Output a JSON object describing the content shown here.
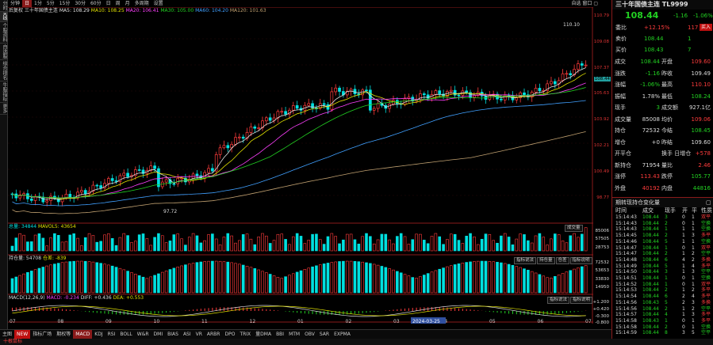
{
  "left_tabs": [
    {
      "label": "分时"
    },
    {
      "label": "K线",
      "active": true
    },
    {
      "label": "个股资料"
    },
    {
      "label": "自选股"
    },
    {
      "label": "综合排名"
    },
    {
      "label": "牛股指标"
    },
    {
      "label": "更多"
    }
  ],
  "toolbar": {
    "items": [
      {
        "label": "分钟"
      },
      {
        "label": "日",
        "active": true
      },
      {
        "label": "1分"
      },
      {
        "label": "5分"
      },
      {
        "label": "15分"
      },
      {
        "label": "30分"
      },
      {
        "label": "60分"
      },
      {
        "label": "日"
      },
      {
        "label": "周"
      },
      {
        "label": "月"
      },
      {
        "label": "多周期"
      },
      {
        "label": "设置"
      }
    ],
    "right": "自选 窗口 ▢"
  },
  "ma_legend": {
    "prefix": "后复权 三十年国债主连",
    "ma5": "MA5: 108.29",
    "ma10": "MA10: 108.25",
    "ma20": "MA20: 106.41",
    "ma30": "MA30: 105.00",
    "ma60": "MA60: 104.20",
    "ma120": "MA120: 101.63"
  },
  "price_axis": [
    "110.79",
    "109.08",
    "107.37",
    "105.63",
    "103.92",
    "102.21",
    "100.49",
    "98.77"
  ],
  "price_tag": "108.44",
  "high_label": "110.10",
  "low_label": "97.72",
  "vol_legend": {
    "title": "总量: 34844",
    "ma": "MAVOL5: 43654"
  },
  "vol_axis": [
    "85006",
    "57505",
    "28753"
  ],
  "vol_btn": "成交量",
  "oi_legend": {
    "title": "持仓量: 54708",
    "sub": "仓差: -839"
  },
  "oi_buttons": [
    "指标说法",
    "持仓量",
    "仓差",
    "指标说明"
  ],
  "oi_axis": [
    "72532",
    "53653",
    "33830",
    "14950"
  ],
  "macd_legend": {
    "title": "MACD(12,26,9)",
    "macd": "MACD: -0.234",
    "dif": "DIFF: +0.436",
    "dea": "DEA: +0.553"
  },
  "macd_buttons": [
    "指标说法",
    "指标说明"
  ],
  "macd_axis": [
    "+1.200",
    "+0.420",
    "-0.300",
    "-0.800"
  ],
  "x_labels": [
    "07",
    "08",
    "09",
    "10",
    "11",
    "12",
    "01",
    "02",
    "03",
    "04",
    "05",
    "06",
    "07"
  ],
  "date_tag": "2024-03-25",
  "bottom_tabs": [
    {
      "label": "主图"
    },
    {
      "label": "NEW"
    },
    {
      "label": "指标广场"
    },
    {
      "label": "期权等"
    },
    {
      "label": "MACD",
      "active": true
    },
    {
      "label": "KDJ"
    },
    {
      "label": "RSI"
    },
    {
      "label": "BOLL"
    },
    {
      "label": "W&R"
    },
    {
      "label": "DMI"
    },
    {
      "label": "BIAS"
    },
    {
      "label": "ASI"
    },
    {
      "label": "VR"
    },
    {
      "label": "ARBR"
    },
    {
      "label": "DPO"
    },
    {
      "label": "TRIX"
    },
    {
      "label": "量DMA"
    },
    {
      "label": "BBI"
    },
    {
      "label": "MTM"
    },
    {
      "label": "OBV"
    },
    {
      "label": "SAR"
    },
    {
      "label": "EXPMA"
    }
  ],
  "status": "十根鼠标",
  "quote": {
    "name": "三十年国债主连 TL9999",
    "price": "108.44",
    "change": "-1.16",
    "pct": "-1.06%"
  },
  "ticket": [
    {
      "l": "委比",
      "v": "+12.15%",
      "v2": "117",
      "v2c": "red",
      "vc": "red",
      "tag": "买入"
    },
    {
      "l": "卖价",
      "v": "108.44",
      "v2": "1",
      "vc": "green",
      "v2c": "green"
    },
    {
      "l": "买价",
      "v": "108.43",
      "v2": "7",
      "vc": "green",
      "v2c": "green"
    }
  ],
  "stats": [
    [
      "成交",
      "108.44",
      "green",
      "开盘",
      "109.60",
      "red"
    ],
    [
      "涨跌",
      "-1.16",
      "green",
      "昨收",
      "109.49",
      "white"
    ],
    [
      "涨幅",
      "-1.06%",
      "green",
      "最高",
      "110.10",
      "red"
    ],
    [
      "振幅",
      "1.78%",
      "white",
      "最低",
      "108.24",
      "green"
    ],
    [
      "现手",
      "3",
      "green",
      "成交额",
      "927.1亿",
      "white"
    ],
    [
      "成交量",
      "85008",
      "white",
      "均价",
      "109.06",
      "red"
    ],
    [
      "持仓",
      "72532",
      "white",
      "今结",
      "108.45",
      "green"
    ],
    [
      "增仓",
      "+0",
      "white",
      "昨结",
      "109.60",
      "white"
    ],
    [
      "开平仓",
      "",
      "white",
      "换手 日增仓",
      "+578",
      "red"
    ],
    [
      "新持仓",
      "71954",
      "white",
      "量比",
      "2.46",
      "red"
    ],
    [
      "涨停",
      "113.43",
      "red",
      "跌停",
      "105.77",
      "green"
    ],
    [
      "外盘",
      "40192",
      "red",
      "内盘",
      "44816",
      "green"
    ]
  ],
  "ticks_title": "期转现持仓变化量",
  "ticks_head": [
    "时间",
    "成交",
    "现手",
    "开",
    "平",
    "性质"
  ],
  "ticks": [
    [
      "15:14:43",
      "108.44",
      "3",
      "0",
      "1",
      "双平"
    ],
    [
      "15:14:43",
      "108.44",
      "2",
      "0",
      "1",
      "空换"
    ],
    [
      "15:14:43",
      "108.44",
      "1",
      "1",
      "1",
      "空换"
    ],
    [
      "15:14:45",
      "108.44",
      "2",
      "1",
      "3",
      "多平"
    ],
    [
      "15:14:46",
      "108.44",
      "5",
      "1",
      "1",
      "空换"
    ],
    [
      "15:14:47",
      "108.44",
      "1",
      "0",
      "1",
      "双平"
    ],
    [
      "15:14:47",
      "108.44",
      "2",
      "1",
      "2",
      "空平"
    ],
    [
      "15:14:48",
      "108.44",
      "6",
      "4",
      "2",
      "多换"
    ],
    [
      "15:14:49",
      "108.44",
      "5",
      "1",
      "4",
      "多平"
    ],
    [
      "15:14:50",
      "108.44",
      "3",
      "1",
      "3",
      "空平"
    ],
    [
      "15:14:51",
      "108.44",
      "1",
      "0",
      "1",
      "空换"
    ],
    [
      "15:14:52",
      "108.44",
      "1",
      "0",
      "1",
      "双平"
    ],
    [
      "15:14:53",
      "108.44",
      "2",
      "1",
      "2",
      "多平"
    ],
    [
      "15:14:54",
      "108.44",
      "6",
      "2",
      "4",
      "多平"
    ],
    [
      "15:14:56",
      "108.43",
      "5",
      "2",
      "3",
      "多换"
    ],
    [
      "15:14:56",
      "108.44",
      "2",
      "1",
      "2",
      "空平"
    ],
    [
      "15:14:57",
      "108.44",
      "4",
      "1",
      "3",
      "多平"
    ],
    [
      "15:14:58",
      "108.43",
      "1",
      "0",
      "1",
      "多平"
    ],
    [
      "15:14:58",
      "108.44",
      "2",
      "0",
      "1",
      "空换"
    ],
    [
      "15:14:59",
      "108.44",
      "8",
      "3",
      "5",
      "空平"
    ]
  ],
  "colors": {
    "up": "#ff3c3c",
    "down": "#00e0e0",
    "ma5": "#e0e0e0",
    "ma10": "#e0e000",
    "ma20": "#ff40ff",
    "ma30": "#22d122",
    "ma60": "#40a0ff",
    "ma120": "#c0a070"
  }
}
